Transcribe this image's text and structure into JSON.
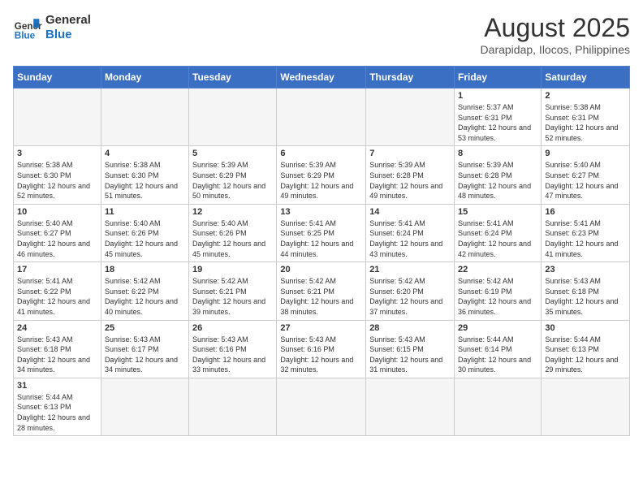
{
  "logo": {
    "text_general": "General",
    "text_blue": "Blue"
  },
  "header": {
    "month_year": "August 2025",
    "location": "Darapidap, Ilocos, Philippines"
  },
  "days_of_week": [
    "Sunday",
    "Monday",
    "Tuesday",
    "Wednesday",
    "Thursday",
    "Friday",
    "Saturday"
  ],
  "weeks": [
    [
      {
        "day": "",
        "info": ""
      },
      {
        "day": "",
        "info": ""
      },
      {
        "day": "",
        "info": ""
      },
      {
        "day": "",
        "info": ""
      },
      {
        "day": "",
        "info": ""
      },
      {
        "day": "1",
        "info": "Sunrise: 5:37 AM\nSunset: 6:31 PM\nDaylight: 12 hours and 53 minutes."
      },
      {
        "day": "2",
        "info": "Sunrise: 5:38 AM\nSunset: 6:31 PM\nDaylight: 12 hours and 52 minutes."
      }
    ],
    [
      {
        "day": "3",
        "info": "Sunrise: 5:38 AM\nSunset: 6:30 PM\nDaylight: 12 hours and 52 minutes."
      },
      {
        "day": "4",
        "info": "Sunrise: 5:38 AM\nSunset: 6:30 PM\nDaylight: 12 hours and 51 minutes."
      },
      {
        "day": "5",
        "info": "Sunrise: 5:39 AM\nSunset: 6:29 PM\nDaylight: 12 hours and 50 minutes."
      },
      {
        "day": "6",
        "info": "Sunrise: 5:39 AM\nSunset: 6:29 PM\nDaylight: 12 hours and 49 minutes."
      },
      {
        "day": "7",
        "info": "Sunrise: 5:39 AM\nSunset: 6:28 PM\nDaylight: 12 hours and 49 minutes."
      },
      {
        "day": "8",
        "info": "Sunrise: 5:39 AM\nSunset: 6:28 PM\nDaylight: 12 hours and 48 minutes."
      },
      {
        "day": "9",
        "info": "Sunrise: 5:40 AM\nSunset: 6:27 PM\nDaylight: 12 hours and 47 minutes."
      }
    ],
    [
      {
        "day": "10",
        "info": "Sunrise: 5:40 AM\nSunset: 6:27 PM\nDaylight: 12 hours and 46 minutes."
      },
      {
        "day": "11",
        "info": "Sunrise: 5:40 AM\nSunset: 6:26 PM\nDaylight: 12 hours and 45 minutes."
      },
      {
        "day": "12",
        "info": "Sunrise: 5:40 AM\nSunset: 6:26 PM\nDaylight: 12 hours and 45 minutes."
      },
      {
        "day": "13",
        "info": "Sunrise: 5:41 AM\nSunset: 6:25 PM\nDaylight: 12 hours and 44 minutes."
      },
      {
        "day": "14",
        "info": "Sunrise: 5:41 AM\nSunset: 6:24 PM\nDaylight: 12 hours and 43 minutes."
      },
      {
        "day": "15",
        "info": "Sunrise: 5:41 AM\nSunset: 6:24 PM\nDaylight: 12 hours and 42 minutes."
      },
      {
        "day": "16",
        "info": "Sunrise: 5:41 AM\nSunset: 6:23 PM\nDaylight: 12 hours and 41 minutes."
      }
    ],
    [
      {
        "day": "17",
        "info": "Sunrise: 5:41 AM\nSunset: 6:22 PM\nDaylight: 12 hours and 41 minutes."
      },
      {
        "day": "18",
        "info": "Sunrise: 5:42 AM\nSunset: 6:22 PM\nDaylight: 12 hours and 40 minutes."
      },
      {
        "day": "19",
        "info": "Sunrise: 5:42 AM\nSunset: 6:21 PM\nDaylight: 12 hours and 39 minutes."
      },
      {
        "day": "20",
        "info": "Sunrise: 5:42 AM\nSunset: 6:21 PM\nDaylight: 12 hours and 38 minutes."
      },
      {
        "day": "21",
        "info": "Sunrise: 5:42 AM\nSunset: 6:20 PM\nDaylight: 12 hours and 37 minutes."
      },
      {
        "day": "22",
        "info": "Sunrise: 5:42 AM\nSunset: 6:19 PM\nDaylight: 12 hours and 36 minutes."
      },
      {
        "day": "23",
        "info": "Sunrise: 5:43 AM\nSunset: 6:18 PM\nDaylight: 12 hours and 35 minutes."
      }
    ],
    [
      {
        "day": "24",
        "info": "Sunrise: 5:43 AM\nSunset: 6:18 PM\nDaylight: 12 hours and 34 minutes."
      },
      {
        "day": "25",
        "info": "Sunrise: 5:43 AM\nSunset: 6:17 PM\nDaylight: 12 hours and 34 minutes."
      },
      {
        "day": "26",
        "info": "Sunrise: 5:43 AM\nSunset: 6:16 PM\nDaylight: 12 hours and 33 minutes."
      },
      {
        "day": "27",
        "info": "Sunrise: 5:43 AM\nSunset: 6:16 PM\nDaylight: 12 hours and 32 minutes."
      },
      {
        "day": "28",
        "info": "Sunrise: 5:43 AM\nSunset: 6:15 PM\nDaylight: 12 hours and 31 minutes."
      },
      {
        "day": "29",
        "info": "Sunrise: 5:44 AM\nSunset: 6:14 PM\nDaylight: 12 hours and 30 minutes."
      },
      {
        "day": "30",
        "info": "Sunrise: 5:44 AM\nSunset: 6:13 PM\nDaylight: 12 hours and 29 minutes."
      }
    ],
    [
      {
        "day": "31",
        "info": "Sunrise: 5:44 AM\nSunset: 6:13 PM\nDaylight: 12 hours and 28 minutes."
      },
      {
        "day": "",
        "info": ""
      },
      {
        "day": "",
        "info": ""
      },
      {
        "day": "",
        "info": ""
      },
      {
        "day": "",
        "info": ""
      },
      {
        "day": "",
        "info": ""
      },
      {
        "day": "",
        "info": ""
      }
    ]
  ]
}
